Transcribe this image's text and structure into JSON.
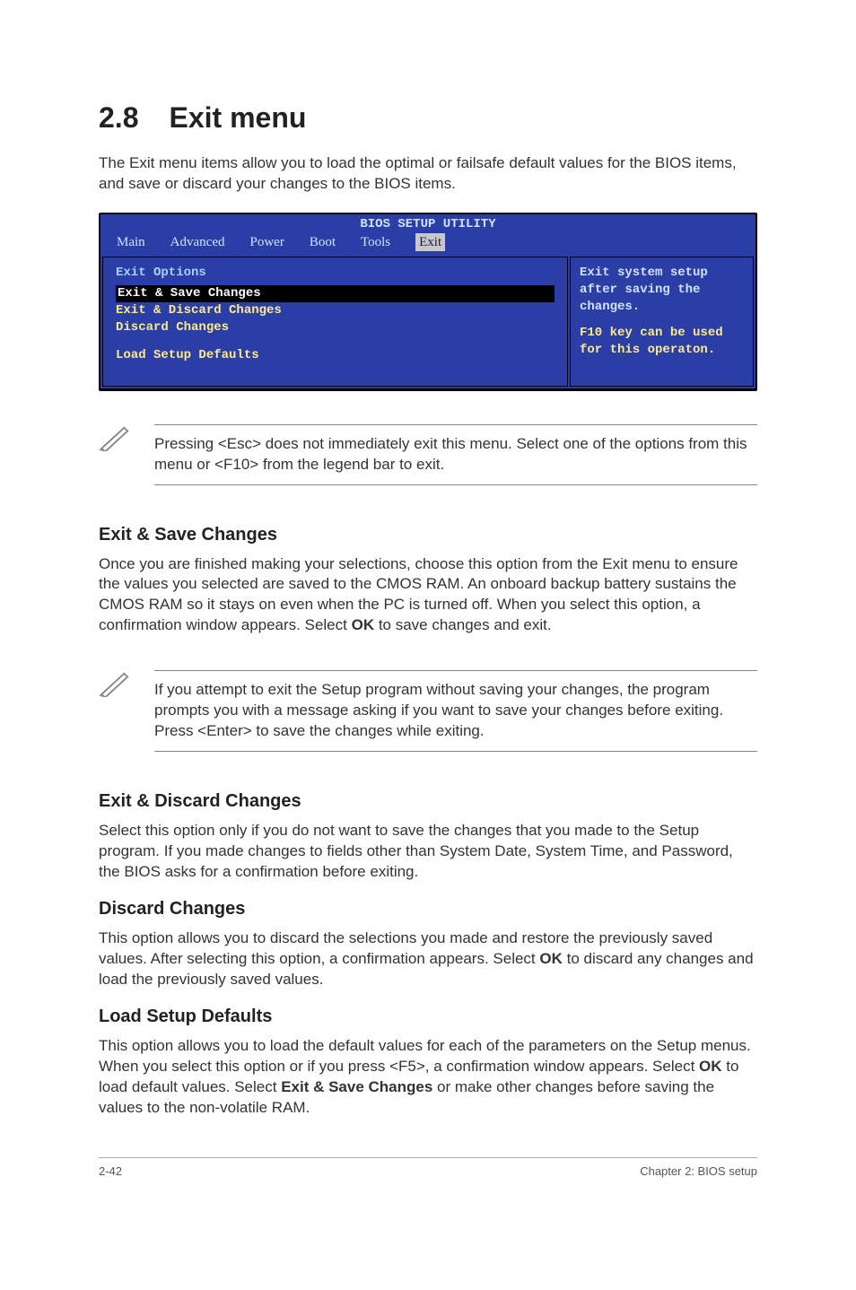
{
  "section": {
    "number": "2.8",
    "title": "Exit menu"
  },
  "intro": "The Exit menu items allow you to load the optimal or failsafe default values for the BIOS items, and save or discard your changes to the BIOS items.",
  "bios": {
    "title": "BIOS SETUP UTILITY",
    "tabs": [
      "Main",
      "Advanced",
      "Power",
      "Boot",
      "Tools",
      "Exit"
    ],
    "active_tab": "Exit",
    "left_header": "Exit Options",
    "items": [
      {
        "label": "Exit & Save Changes",
        "selected": true
      },
      {
        "label": "Exit & Discard Changes",
        "selected": false
      },
      {
        "label": "Discard Changes",
        "selected": false
      }
    ],
    "load_defaults": "Load Setup Defaults",
    "help": {
      "l1": "Exit system setup",
      "l2": "after saving the changes.",
      "l3": "F10 key can be used for this operaton."
    }
  },
  "note1": "Pressing <Esc> does not immediately exit this menu. Select one of the options from this menu or <F10> from the legend bar to exit.",
  "sections": {
    "save": {
      "title": "Exit & Save Changes",
      "body_a": "Once you are finished making your selections, choose this option from the Exit menu to ensure the values you selected are saved to the CMOS RAM. An onboard backup battery sustains the CMOS RAM so it stays on even when the PC is turned off. When you select this option, a confirmation window appears. Select ",
      "body_ok": "OK",
      "body_b": " to save changes and exit."
    },
    "note2": " If you attempt to exit the Setup program without saving your changes, the program prompts you with a message asking if you want to save your changes before exiting. Press <Enter>  to save the  changes while exiting.",
    "discard_exit": {
      "title": "Exit & Discard Changes",
      "body": "Select this option only if you do not want to save the changes that you  made to the Setup program. If you made changes to fields other than System Date, System Time, and Password, the BIOS asks for a confirmation before exiting."
    },
    "discard": {
      "title": "Discard Changes",
      "body_a": "This option allows you to discard the selections you made and restore the previously saved values. After selecting this option, a confirmation appears. Select ",
      "body_ok": "OK",
      "body_b": " to discard any changes and load the previously saved values."
    },
    "load": {
      "title": "Load Setup Defaults",
      "body_a": "This option allows you to load the default values for each of the parameters on the Setup menus. When you select this option or if you press <F5>, a confirmation window appears. Select ",
      "body_ok": "OK",
      "body_b": " to load default values. Select ",
      "body_bold2": "Exit & Save Changes",
      "body_c": " or make other changes before saving the values to the non-volatile RAM."
    }
  },
  "footer": {
    "left": "2-42",
    "right": "Chapter 2: BIOS setup"
  }
}
